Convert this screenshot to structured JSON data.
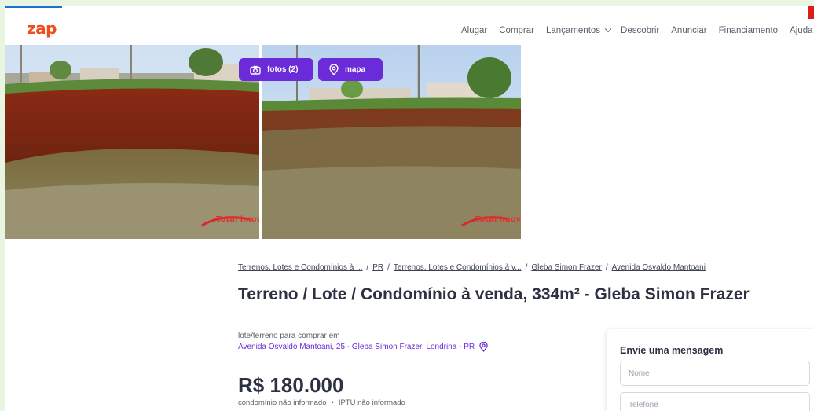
{
  "header": {
    "logo": "zap",
    "nav": {
      "alugar": "Alugar",
      "comprar": "Comprar",
      "lancamentos": "Lançamentos",
      "descobrir": "Descobrir",
      "anunciar": "Anunciar",
      "financiamento": "Financiamento",
      "ajuda": "Ajuda"
    }
  },
  "gallery": {
    "photos_label": "fotos (2)",
    "map_label": "mapa",
    "watermark": "Total imoveis"
  },
  "breadcrumb": {
    "item1": "Terrenos, Lotes e Condomínios à ...",
    "item2": "PR",
    "item3": "Terrenos, Lotes e Condomínios à v...",
    "item4": "Gleba Simon Frazer",
    "item5": "Avenida Osvaldo Mantoani"
  },
  "listing": {
    "title": "Terreno / Lote / Condomínio à venda, 334m² - Gleba Simon Frazer",
    "subtitle": "lote/terreno para comprar em",
    "address": "Avenida Osvaldo Mantoani, 25 - Gleba Simon Frazer, Londrina - PR",
    "price": "R$ 180.000",
    "condo_fee": "condomínio não informado",
    "iptu": "IPTU não informado"
  },
  "contact": {
    "heading": "Envie uma mensagem",
    "name_placeholder": "Nome",
    "phone_placeholder": "Telefone"
  },
  "colors": {
    "brand_orange": "#f04f1d",
    "accent_purple": "#6c2bd9",
    "text_dark": "#2d3142"
  }
}
